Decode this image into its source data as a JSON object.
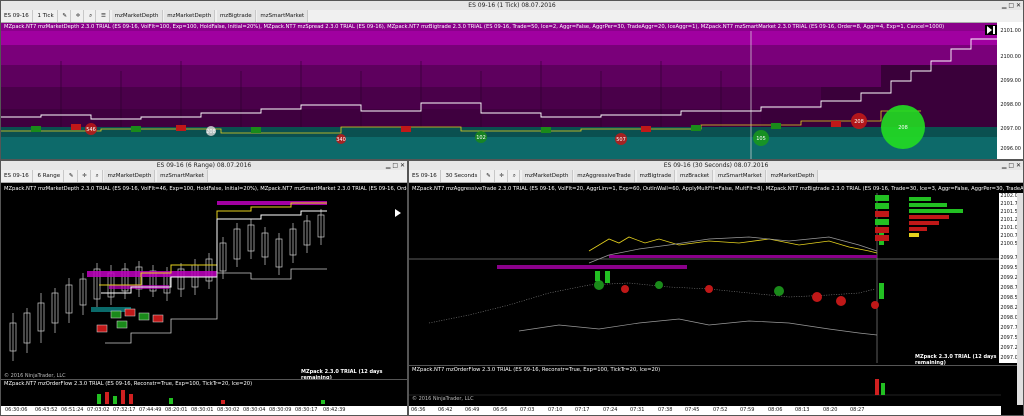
{
  "colors": {
    "accent_magenta": "#c000c0",
    "purple_band": "#5a005a",
    "teal_band": "#0a6060",
    "bid_green": "#22c022",
    "ask_red": "#d02020",
    "yellow_line": "#e6d21e",
    "white_line": "#ffffff"
  },
  "top_window": {
    "title": "ES 09-16 (1 Tick)  08.07.2016",
    "toolbar": {
      "instrument": "ES 09-16",
      "interval": "1 Tick",
      "icons": [
        "pencil-icon",
        "crosshair-icon",
        "zoom-icon",
        "properties-icon"
      ],
      "buttons": [
        "mzMarketDepth",
        "mzMarketDepth",
        "mzBigtrade",
        "mzSmartMarket"
      ]
    },
    "indicator_line": "MZpack.NT7 mzMarketDepth 2.3.0 TRIAL (ES 09-16, VolFlt=100, Exp=100, HoldFalse, Initial=20%), MZpack.NT7 mzSpread 2.3.0 TRIAL (ES 09-16), MZpack.NT7 mzBigtrade 2.3.0 TRIAL (ES 09-16, Trade=50, Ice=2, Aggr=False, AggrPer=30, TradeAggr=20, IceAggr=1), MZpack.NT7 mzSmartMarket 2.3.0 TRIAL (ES 09-16, Order=8, Aggr=4, Exp=1, Cancel=1000)",
    "price_labels": [
      "2101.00",
      "2100.00",
      "2099.00",
      "2098.00",
      "2097.00",
      "2096.00"
    ],
    "bubble_labels": [
      "546",
      "208",
      "340",
      "102",
      "507",
      "105",
      "208",
      "208"
    ]
  },
  "left_window": {
    "title": "ES 09-16 (6 Range)  08.07.2016",
    "toolbar": {
      "instrument": "ES 09-16",
      "interval": "6 Range",
      "buttons": [
        "mzMarketDepth",
        "mzSmartMarket"
      ]
    },
    "indicator_line": "MZpack.NT7 mzMarketDepth 2.3.0 TRIAL (ES 09-16, VolFlt=46, Exp=100, HoldFalse, Initial=20%), MZpack.NT7 mzSmartMarket 2.3.0 TRIAL (ES 09-16, Order=12, Aggr=4, Exp=48, Cancel=1000)",
    "trial_text": "MZpack 2.3.0 TRIAL   (12 days remaining)",
    "copyright": "© 2016 NinjaTrader, LLC",
    "lower_indicator": "MZpack.NT7 mzOrderFlow 2.3.0 TRIAL (ES 09-16, Reconstr=True, Exp=100, TickTr=20, Ice=20)",
    "time_labels": [
      "06:30:06",
      "06:43:52",
      "06:51:24",
      "07:03:02",
      "07:32:17",
      "07:44:49",
      "08:20:01",
      "08:30:01",
      "08:30:02",
      "08:30:04",
      "08:30:09",
      "08:30:17",
      "08:42:39"
    ]
  },
  "right_window": {
    "title": "ES 09-16 (30 Seconds)  08.07.2016",
    "toolbar": {
      "instrument": "ES 09-16",
      "interval": "30 Seconds",
      "buttons": [
        "mzMarketDepth",
        "mzAggressiveTrade",
        "mzBigtrade",
        "mzBracket",
        "mzSmartMarket",
        "mzMarketDepth"
      ]
    },
    "indicator_line": "MZpack.NT7 mzAggressiveTrade 2.3.0 TRIAL (ES 09-16, VolFlt=20, AggrLim=1, Exp=60, OutlnWall=60, ApplyMultFlt=False, MultFlt=8), MZpack.NT7 mzBigtrade 2.3.0 TRIAL (ES 09-16, Trade=30, Ice=3, Aggr=False, AggrPer=30, TradeAggr=20, IceAggr=1), MZpack.NT7 mzBracket 2.3.0 TRIAL (ES 09-16)",
    "price_labels": [
      "2102.00",
      "2101.75",
      "2101.50",
      "2101.25",
      "2101.00",
      "2100.75",
      "2100.50",
      "2099.75",
      "2099.50",
      "2099.25",
      "2098.75",
      "2098.50",
      "2098.25",
      "2098.00",
      "2097.75",
      "2097.50",
      "2097.25",
      "2097.00"
    ],
    "trial_text": "MZpack 2.3.0 TRIAL   (12 days remaining)",
    "copyright": "© 2016 NinjaTrader, LLC",
    "lower_indicator": "MZpack.NT7 mzOrderFlow 2.3.0 TRIAL (ES 09-16, Reconstr=True, Exp=100, TickTr=20, Ice=20)",
    "time_labels": [
      "06:36",
      "06:42",
      "06:49",
      "06:56",
      "07:03",
      "07:10",
      "07:17",
      "07:24",
      "07:31",
      "07:38",
      "07:45",
      "07:52",
      "07:59",
      "08:06",
      "08:13",
      "08:20",
      "08:27"
    ]
  }
}
